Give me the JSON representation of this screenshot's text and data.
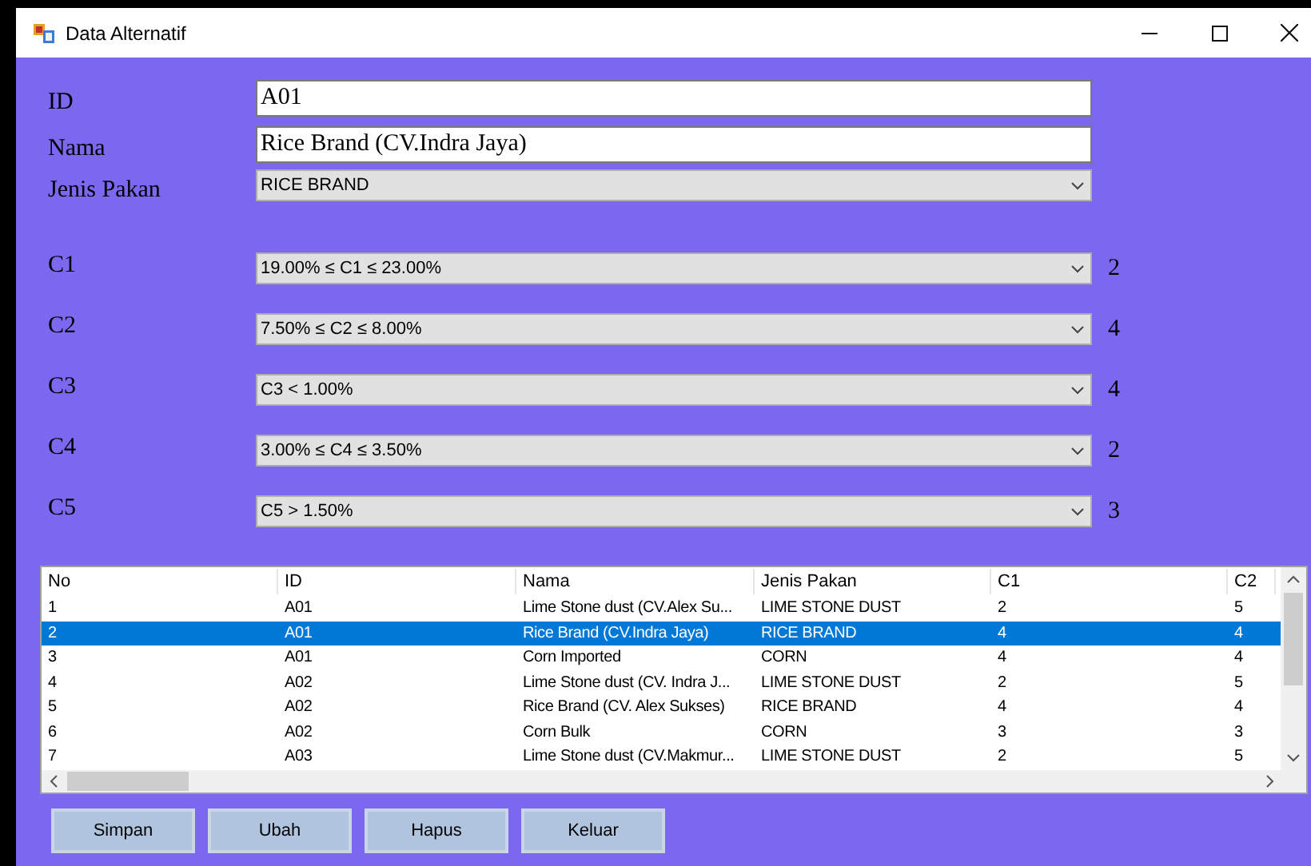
{
  "window": {
    "title": "Data Alternatif"
  },
  "fields": [
    {
      "label": "ID",
      "kind": "text",
      "value": "A01"
    },
    {
      "label": "Nama",
      "kind": "text",
      "value": "Rice Brand (CV.Indra Jaya)"
    },
    {
      "label": "Jenis Pakan",
      "kind": "combo",
      "value": "RICE BRAND"
    }
  ],
  "criteria": [
    {
      "label": "C1",
      "value": "19.00% ≤ C1 ≤ 23.00%",
      "score": "2"
    },
    {
      "label": "C2",
      "value": "7.50% ≤ C2 ≤ 8.00%",
      "score": "4"
    },
    {
      "label": "C3",
      "value": "C3 < 1.00%",
      "score": "4"
    },
    {
      "label": "C4",
      "value": "3.00% ≤ C4 ≤ 3.50%",
      "score": "2"
    },
    {
      "label": "C5",
      "value": "C5 > 1.50%",
      "score": "3"
    }
  ],
  "table": {
    "columns": [
      "No",
      "ID",
      "Nama",
      "Jenis Pakan",
      "C1",
      "C2"
    ],
    "rows": [
      {
        "cells": [
          "1",
          "A01",
          "Lime Stone dust (CV.Alex Su...",
          "LIME STONE DUST",
          "2",
          "5"
        ],
        "selected": false
      },
      {
        "cells": [
          "2",
          "A01",
          "Rice Brand (CV.Indra Jaya)",
          "RICE BRAND",
          "4",
          "4"
        ],
        "selected": true
      },
      {
        "cells": [
          "3",
          "A01",
          "Corn Imported",
          "CORN",
          "4",
          "4"
        ],
        "selected": false
      },
      {
        "cells": [
          "4",
          "A02",
          "Lime Stone dust (CV. Indra J...",
          "LIME STONE DUST",
          "2",
          "5"
        ],
        "selected": false
      },
      {
        "cells": [
          "5",
          "A02",
          "Rice Brand (CV. Alex Sukses)",
          "RICE BRAND",
          "4",
          "4"
        ],
        "selected": false
      },
      {
        "cells": [
          "6",
          "A02",
          "Corn Bulk",
          "CORN",
          "3",
          "3"
        ],
        "selected": false
      },
      {
        "cells": [
          "7",
          "A03",
          "Lime Stone dust (CV.Makmur...",
          "LIME STONE DUST",
          "2",
          "5"
        ],
        "selected": false
      }
    ]
  },
  "buttons": [
    "Simpan",
    "Ubah",
    "Hapus",
    "Keluar"
  ]
}
